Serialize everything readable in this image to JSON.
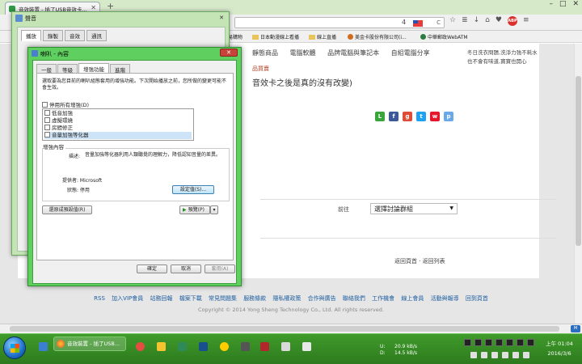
{
  "browser": {
    "tab_title": "音效裝置 - 插了USB音效卡...",
    "badge_count": "4",
    "bookmarks": [
      "易購物",
      "日本動漫線上看播",
      "線上直播",
      "美金卡股份有限公司(i...",
      "中華郵政WebATM"
    ]
  },
  "page": {
    "categories": [
      "靜態商品",
      "電腦軟體",
      "品牌電腦與筆記本",
      "自組電腦分享"
    ],
    "red_label": "品買賣",
    "subtitle": "音效卡之後是真的沒有改變)",
    "sidenote": [
      "冬日洗衣問題,洗淨力強不耗水",
      "也不會有味道,寶寶也開心"
    ],
    "topic_label": "前往",
    "topic_select": "選擇討論群組",
    "backlinks": "返回頁首 · 返回列表",
    "footer_links": [
      "RSS",
      "加入VIP會員",
      "站務回報",
      "檔案下載",
      "常見問題集",
      "服務條款",
      "隱私權政策",
      "合作與廣告",
      "聯絡我們",
      "工作機會",
      "線上會員",
      "活動與報導",
      "回到頁首"
    ],
    "copyright": "Copyright © 2014 Yong Sheng Technology Co., Ltd. All rights reserved."
  },
  "sound_dialog": {
    "title": "聲音",
    "tabs": [
      "播放",
      "錄製",
      "音效",
      "通訊"
    ]
  },
  "props_dialog": {
    "title": "喇叭 - 內容",
    "tabs": [
      "一般",
      "等級",
      "增強功能",
      "進階"
    ],
    "description": "選取要為您目前的喇叭組態套用的增強功能。下次開始播放之前，您所做的變更可能不會生效。",
    "disable_all": "停用所有增強(D)",
    "enhancements": [
      "低音加強",
      "虛擬環繞",
      "房間修正",
      "音量加強等化器"
    ],
    "group_label": "增強內容",
    "desc_label": "描述:",
    "desc_text": "音量加強等化器利用人類聽覺的理解力，降低認知音量的差異。",
    "provider_label": "提供者: Microsoft",
    "status_label": "狀態: 停用",
    "settings_button": "設定值(S)...",
    "restore_button": "還原成預設值(R)",
    "preview_button": "預覽(P)",
    "ok": "確定",
    "cancel": "取消",
    "apply": "套用(A)"
  },
  "taskbar": {
    "app_title": "音效裝置 - 插了USB...",
    "net_up_label": "U:",
    "net_up": "20.9 kB/s",
    "net_down_label": "D:",
    "net_down": "14.5 kB/s",
    "time": "上午 01:04",
    "date": "2016/3/6"
  }
}
